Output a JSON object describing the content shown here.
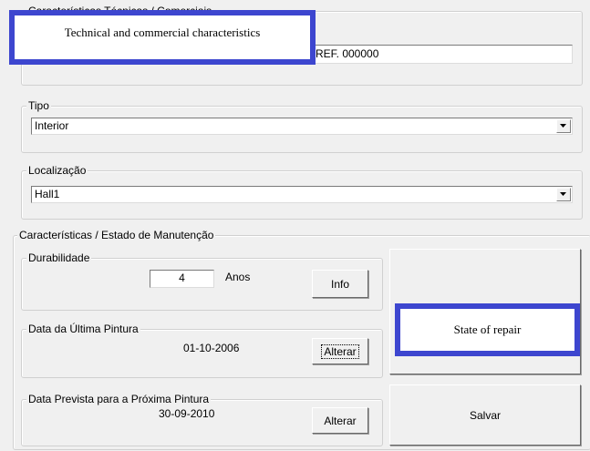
{
  "callouts": {
    "technical": "Technical and commercial characteristics",
    "repair": "State of repair"
  },
  "top_group": {
    "legend_partial": "Características Técnicas / Comerciais",
    "ref_value": "REF. 000000"
  },
  "tipo": {
    "legend": "Tipo",
    "value": "Interior"
  },
  "localizacao": {
    "legend": "Localização",
    "value": "Hall1"
  },
  "manutencao": {
    "legend": "Características / Estado de Manutenção",
    "durabilidade": {
      "legend": "Durabilidade",
      "value": "4",
      "unit": "Anos",
      "info_label": "Info"
    },
    "ultima": {
      "legend": "Data da Última Pintura",
      "date": "01-10-2006",
      "alterar_label": "Alterar"
    },
    "proxima": {
      "legend": "Data Prevista para a Próxima Pintura",
      "date": "30-09-2010",
      "alterar_label": "Alterar"
    },
    "salvar_label": "Salvar"
  },
  "colors": {
    "callout_border": "#3d46cf",
    "background": "#f0f0f0"
  }
}
